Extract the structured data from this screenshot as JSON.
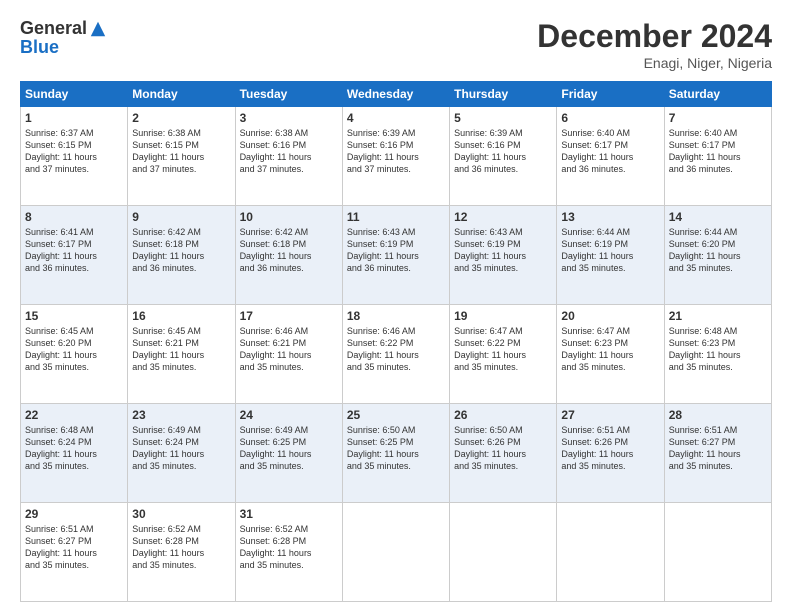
{
  "header": {
    "logo_general": "General",
    "logo_blue": "Blue",
    "month_title": "December 2024",
    "location": "Enagi, Niger, Nigeria"
  },
  "days_header": [
    "Sunday",
    "Monday",
    "Tuesday",
    "Wednesday",
    "Thursday",
    "Friday",
    "Saturday"
  ],
  "weeks": [
    [
      {
        "day": "1",
        "rise": "6:37 AM",
        "set": "6:15 PM",
        "light": "11 hours and 37 minutes."
      },
      {
        "day": "2",
        "rise": "6:38 AM",
        "set": "6:15 PM",
        "light": "11 hours and 37 minutes."
      },
      {
        "day": "3",
        "rise": "6:38 AM",
        "set": "6:16 PM",
        "light": "11 hours and 37 minutes."
      },
      {
        "day": "4",
        "rise": "6:39 AM",
        "set": "6:16 PM",
        "light": "11 hours and 37 minutes."
      },
      {
        "day": "5",
        "rise": "6:39 AM",
        "set": "6:16 PM",
        "light": "11 hours and 36 minutes."
      },
      {
        "day": "6",
        "rise": "6:40 AM",
        "set": "6:17 PM",
        "light": "11 hours and 36 minutes."
      },
      {
        "day": "7",
        "rise": "6:40 AM",
        "set": "6:17 PM",
        "light": "11 hours and 36 minutes."
      }
    ],
    [
      {
        "day": "8",
        "rise": "6:41 AM",
        "set": "6:17 PM",
        "light": "11 hours and 36 minutes."
      },
      {
        "day": "9",
        "rise": "6:42 AM",
        "set": "6:18 PM",
        "light": "11 hours and 36 minutes."
      },
      {
        "day": "10",
        "rise": "6:42 AM",
        "set": "6:18 PM",
        "light": "11 hours and 36 minutes."
      },
      {
        "day": "11",
        "rise": "6:43 AM",
        "set": "6:19 PM",
        "light": "11 hours and 36 minutes."
      },
      {
        "day": "12",
        "rise": "6:43 AM",
        "set": "6:19 PM",
        "light": "11 hours and 35 minutes."
      },
      {
        "day": "13",
        "rise": "6:44 AM",
        "set": "6:19 PM",
        "light": "11 hours and 35 minutes."
      },
      {
        "day": "14",
        "rise": "6:44 AM",
        "set": "6:20 PM",
        "light": "11 hours and 35 minutes."
      }
    ],
    [
      {
        "day": "15",
        "rise": "6:45 AM",
        "set": "6:20 PM",
        "light": "11 hours and 35 minutes."
      },
      {
        "day": "16",
        "rise": "6:45 AM",
        "set": "6:21 PM",
        "light": "11 hours and 35 minutes."
      },
      {
        "day": "17",
        "rise": "6:46 AM",
        "set": "6:21 PM",
        "light": "11 hours and 35 minutes."
      },
      {
        "day": "18",
        "rise": "6:46 AM",
        "set": "6:22 PM",
        "light": "11 hours and 35 minutes."
      },
      {
        "day": "19",
        "rise": "6:47 AM",
        "set": "6:22 PM",
        "light": "11 hours and 35 minutes."
      },
      {
        "day": "20",
        "rise": "6:47 AM",
        "set": "6:23 PM",
        "light": "11 hours and 35 minutes."
      },
      {
        "day": "21",
        "rise": "6:48 AM",
        "set": "6:23 PM",
        "light": "11 hours and 35 minutes."
      }
    ],
    [
      {
        "day": "22",
        "rise": "6:48 AM",
        "set": "6:24 PM",
        "light": "11 hours and 35 minutes."
      },
      {
        "day": "23",
        "rise": "6:49 AM",
        "set": "6:24 PM",
        "light": "11 hours and 35 minutes."
      },
      {
        "day": "24",
        "rise": "6:49 AM",
        "set": "6:25 PM",
        "light": "11 hours and 35 minutes."
      },
      {
        "day": "25",
        "rise": "6:50 AM",
        "set": "6:25 PM",
        "light": "11 hours and 35 minutes."
      },
      {
        "day": "26",
        "rise": "6:50 AM",
        "set": "6:26 PM",
        "light": "11 hours and 35 minutes."
      },
      {
        "day": "27",
        "rise": "6:51 AM",
        "set": "6:26 PM",
        "light": "11 hours and 35 minutes."
      },
      {
        "day": "28",
        "rise": "6:51 AM",
        "set": "6:27 PM",
        "light": "11 hours and 35 minutes."
      }
    ],
    [
      {
        "day": "29",
        "rise": "6:51 AM",
        "set": "6:27 PM",
        "light": "11 hours and 35 minutes."
      },
      {
        "day": "30",
        "rise": "6:52 AM",
        "set": "6:28 PM",
        "light": "11 hours and 35 minutes."
      },
      {
        "day": "31",
        "rise": "6:52 AM",
        "set": "6:28 PM",
        "light": "11 hours and 35 minutes."
      },
      null,
      null,
      null,
      null
    ]
  ],
  "labels": {
    "sunrise": "Sunrise:",
    "sunset": "Sunset:",
    "daylight": "Daylight:"
  }
}
